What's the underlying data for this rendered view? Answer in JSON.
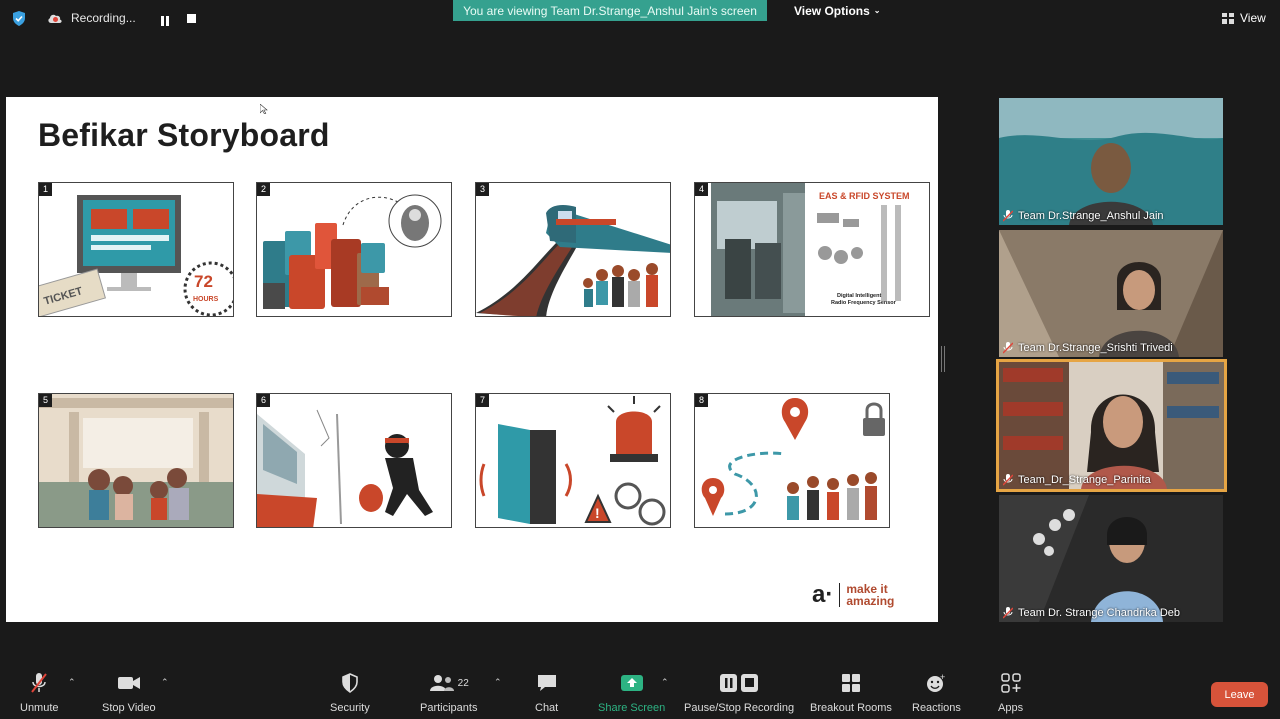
{
  "topbar": {
    "recording_label": "Recording...",
    "viewing_banner": "You are viewing Team Dr.Strange_Anshul Jain's screen",
    "view_options": "View Options",
    "view_label": "View"
  },
  "slide": {
    "title": "Befikar Storyboard",
    "panels": [
      {
        "num": "1",
        "ticket": "TICKET",
        "hours_num": "72",
        "hours_label": "HOURS"
      },
      {
        "num": "2"
      },
      {
        "num": "3"
      },
      {
        "num": "4",
        "system_title": "EAS & RFID SYSTEM",
        "sensor_caption_1": "Digital Intelligent",
        "sensor_caption_2": "Radio Frequency Sensor"
      },
      {
        "num": "5"
      },
      {
        "num": "6"
      },
      {
        "num": "7"
      },
      {
        "num": "8"
      }
    ],
    "brand_mark": "a·",
    "brand_line1": "make it",
    "brand_line2": "amazing"
  },
  "participants": [
    {
      "name": "Team Dr.Strange_Anshul Jain",
      "bg": "#4a8a8c"
    },
    {
      "name": "Team Dr.Strange_Srishti Trivedi",
      "bg": "#8a7a6a"
    },
    {
      "name": "Team_Dr_Strange_Parinita",
      "bg": "#a0866a"
    },
    {
      "name": "Team Dr. Strange Chandrika Deb",
      "bg": "#2a2a2a"
    }
  ],
  "toolbar": {
    "unmute": "Unmute",
    "stop_video": "Stop Video",
    "security": "Security",
    "participants": "Participants",
    "participants_count": "22",
    "chat": "Chat",
    "share_screen": "Share Screen",
    "pause_stop_recording": "Pause/Stop Recording",
    "breakout_rooms": "Breakout Rooms",
    "reactions": "Reactions",
    "apps": "Apps",
    "leave": "Leave"
  },
  "colors": {
    "banner": "#35a18f",
    "share_green": "#2db383",
    "leave_red": "#d7533a",
    "active_border": "#e6a544",
    "accent_orange": "#c9472a"
  }
}
